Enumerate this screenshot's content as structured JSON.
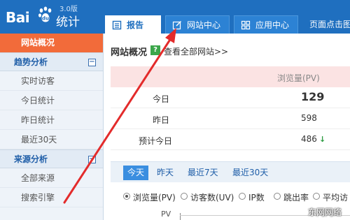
{
  "brand": {
    "bai": "Bai",
    "tongji": "统计",
    "version": "3.0版",
    "accent": "#1f6fbf",
    "paw_color": "#ffffff"
  },
  "tabs": [
    {
      "label": "报告",
      "icon": "report-icon",
      "active": true
    },
    {
      "label": "网站中心",
      "icon": "edit-icon",
      "active": false
    },
    {
      "label": "应用中心",
      "icon": "grid-icon",
      "active": false
    }
  ],
  "page_click": "页面点击图",
  "sidebar": {
    "overview": "网站概况",
    "groups": [
      {
        "label": "趋势分析",
        "toggle": "⊟",
        "items": [
          "实时访客",
          "今日统计",
          "昨日统计",
          "最近30天"
        ]
      },
      {
        "label": "来源分析",
        "toggle": "⊟",
        "items": [
          "全部来源",
          "搜索引擎"
        ]
      }
    ]
  },
  "main": {
    "title": "网站概况",
    "help": "?",
    "see_all": "查看全部网站>>",
    "column_header": "浏览量(PV)",
    "rows": [
      {
        "label": "今日",
        "value": "129"
      },
      {
        "label": "昨日",
        "value": "598"
      },
      {
        "label": "预计今日",
        "value": "486",
        "trend": "↓"
      }
    ],
    "ranges": [
      "今天",
      "昨天",
      "最近7天",
      "最近30天"
    ],
    "metrics": [
      {
        "label": "浏览量(PV)",
        "selected": true
      },
      {
        "label": "访客数(UV)",
        "selected": false
      },
      {
        "label": "IP数",
        "selected": false
      },
      {
        "label": "跳出率",
        "selected": false
      },
      {
        "label": "平均访",
        "selected": false
      }
    ],
    "chart_y_label": "PV"
  },
  "watermark": "东网网络",
  "annotation_color": "#e32b2b"
}
